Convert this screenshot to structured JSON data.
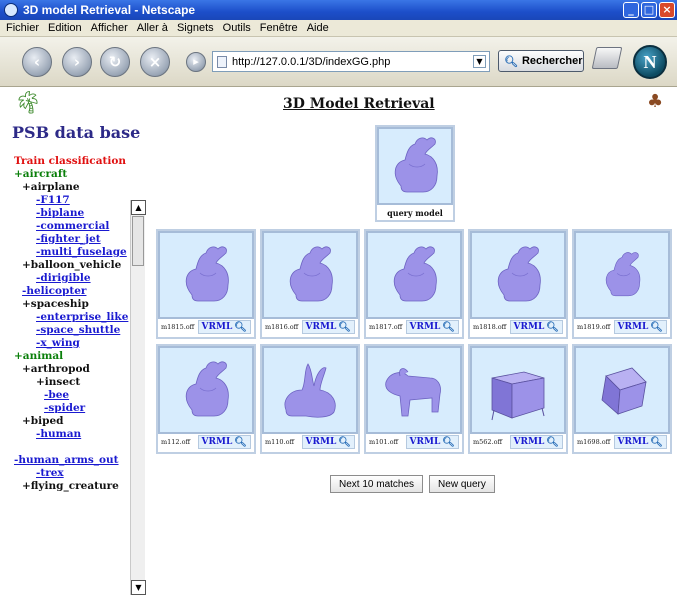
{
  "window": {
    "title": "3D model Retrieval - Netscape",
    "controls": [
      "minimize",
      "maximize",
      "close"
    ]
  },
  "menubar": {
    "items": [
      "Fichier",
      "Edition",
      "Afficher",
      "Aller à",
      "Signets",
      "Outils",
      "Fenêtre",
      "Aide"
    ]
  },
  "toolbar": {
    "url": "http://127.0.0.1/3D/indexGG.php",
    "search_label": "Rechercher",
    "icons": [
      "back-icon",
      "forward-icon",
      "reload-icon",
      "stop-icon",
      "home-icon",
      "print-icon",
      "netscape-logo"
    ]
  },
  "sidebar": {
    "title": "PSB data base",
    "tree": [
      {
        "text": "Train classification",
        "style": "red",
        "indent": 0
      },
      {
        "text": "+aircraft",
        "style": "green",
        "indent": 0
      },
      {
        "text": "+airplane",
        "style": "black",
        "indent": 1
      },
      {
        "text": "-F117",
        "style": "link",
        "indent": 2
      },
      {
        "text": "-biplane",
        "style": "link",
        "indent": 2
      },
      {
        "text": "-commercial",
        "style": "link",
        "indent": 2
      },
      {
        "text": "-fighter_jet",
        "style": "link",
        "indent": 2
      },
      {
        "text": "-multi_fuselage",
        "style": "link",
        "indent": 2
      },
      {
        "text": "+balloon_vehicle",
        "style": "black",
        "indent": 1
      },
      {
        "text": "-dirigible",
        "style": "link",
        "indent": 2
      },
      {
        "text": "-helicopter",
        "style": "link",
        "indent": 1
      },
      {
        "text": "+spaceship",
        "style": "black",
        "indent": 1
      },
      {
        "text": "-enterprise_like",
        "style": "link",
        "indent": 2
      },
      {
        "text": "-space_shuttle",
        "style": "link",
        "indent": 2
      },
      {
        "text": "-x_wing",
        "style": "link",
        "indent": 2
      },
      {
        "text": "+animal",
        "style": "green",
        "indent": 0
      },
      {
        "text": "+arthropod",
        "style": "black",
        "indent": 1
      },
      {
        "text": "+insect",
        "style": "black",
        "indent": 2
      },
      {
        "text": "-bee",
        "style": "link",
        "indent": 3
      },
      {
        "text": "-spider",
        "style": "link",
        "indent": 3
      },
      {
        "text": "+biped",
        "style": "black",
        "indent": 1
      },
      {
        "text": "-human",
        "style": "link",
        "indent": 2
      },
      {
        "text": "",
        "style": "black",
        "indent": 0
      },
      {
        "text": "-human_arms_out",
        "style": "link",
        "indent": 0
      },
      {
        "text": "-trex",
        "style": "link",
        "indent": 2
      },
      {
        "text": "+flying_creature",
        "style": "black",
        "indent": 1
      }
    ]
  },
  "main": {
    "title": "3D Model Retrieval",
    "query_caption": "query model",
    "vrml_label": "VRML",
    "results": [
      {
        "file": "m1815.off",
        "shape": "bunny"
      },
      {
        "file": "m1816.off",
        "shape": "bunny"
      },
      {
        "file": "m1817.off",
        "shape": "bunny"
      },
      {
        "file": "m1818.off",
        "shape": "bunny"
      },
      {
        "file": "m1819.off",
        "shape": "bunny-small"
      },
      {
        "file": "m112.off",
        "shape": "bunny"
      },
      {
        "file": "m110.off",
        "shape": "rabbit"
      },
      {
        "file": "m101.off",
        "shape": "dog"
      },
      {
        "file": "m562.off",
        "shape": "cabinet"
      },
      {
        "file": "m1698.off",
        "shape": "cube"
      }
    ],
    "next_button": "Next 10 matches",
    "new_query_button": "New query"
  },
  "colors": {
    "titlebar": "#1c4ec9",
    "model_fill": "#9c92e8",
    "thumb_bg": "#d7ecfd",
    "link": "#1a1ad0"
  }
}
